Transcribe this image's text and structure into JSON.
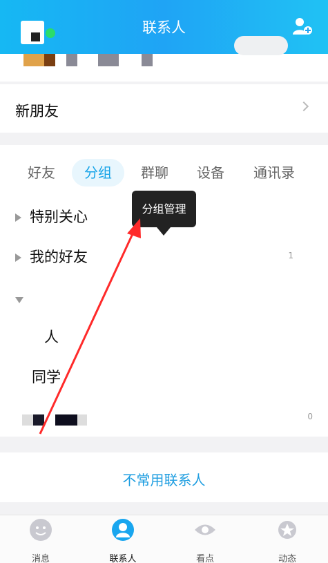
{
  "header": {
    "title": "联系人"
  },
  "new_friend": {
    "label": "新朋友"
  },
  "tabs": [
    {
      "label": "好友"
    },
    {
      "label": "分组"
    },
    {
      "label": "群聊"
    },
    {
      "label": "设备"
    },
    {
      "label": "通讯录"
    }
  ],
  "tooltip": {
    "label": "分组管理"
  },
  "groups": [
    {
      "label": "特别关心",
      "count": ""
    },
    {
      "label": "我的好友",
      "count": "1"
    },
    {
      "label": "人",
      "count": ""
    },
    {
      "label": "同学",
      "count": ""
    },
    {
      "label": "",
      "count": "0"
    }
  ],
  "uncommon": {
    "label": "不常用联系人"
  },
  "bottom_nav": [
    {
      "label": "消息",
      "icon": "message-face-icon"
    },
    {
      "label": "联系人",
      "icon": "contacts-icon"
    },
    {
      "label": "看点",
      "icon": "eye-icon"
    },
    {
      "label": "动态",
      "icon": "star-planet-icon"
    }
  ],
  "colors": {
    "header": "#1fa4f5",
    "accent": "#17a4e8",
    "arrow": "#ff2a2a"
  }
}
